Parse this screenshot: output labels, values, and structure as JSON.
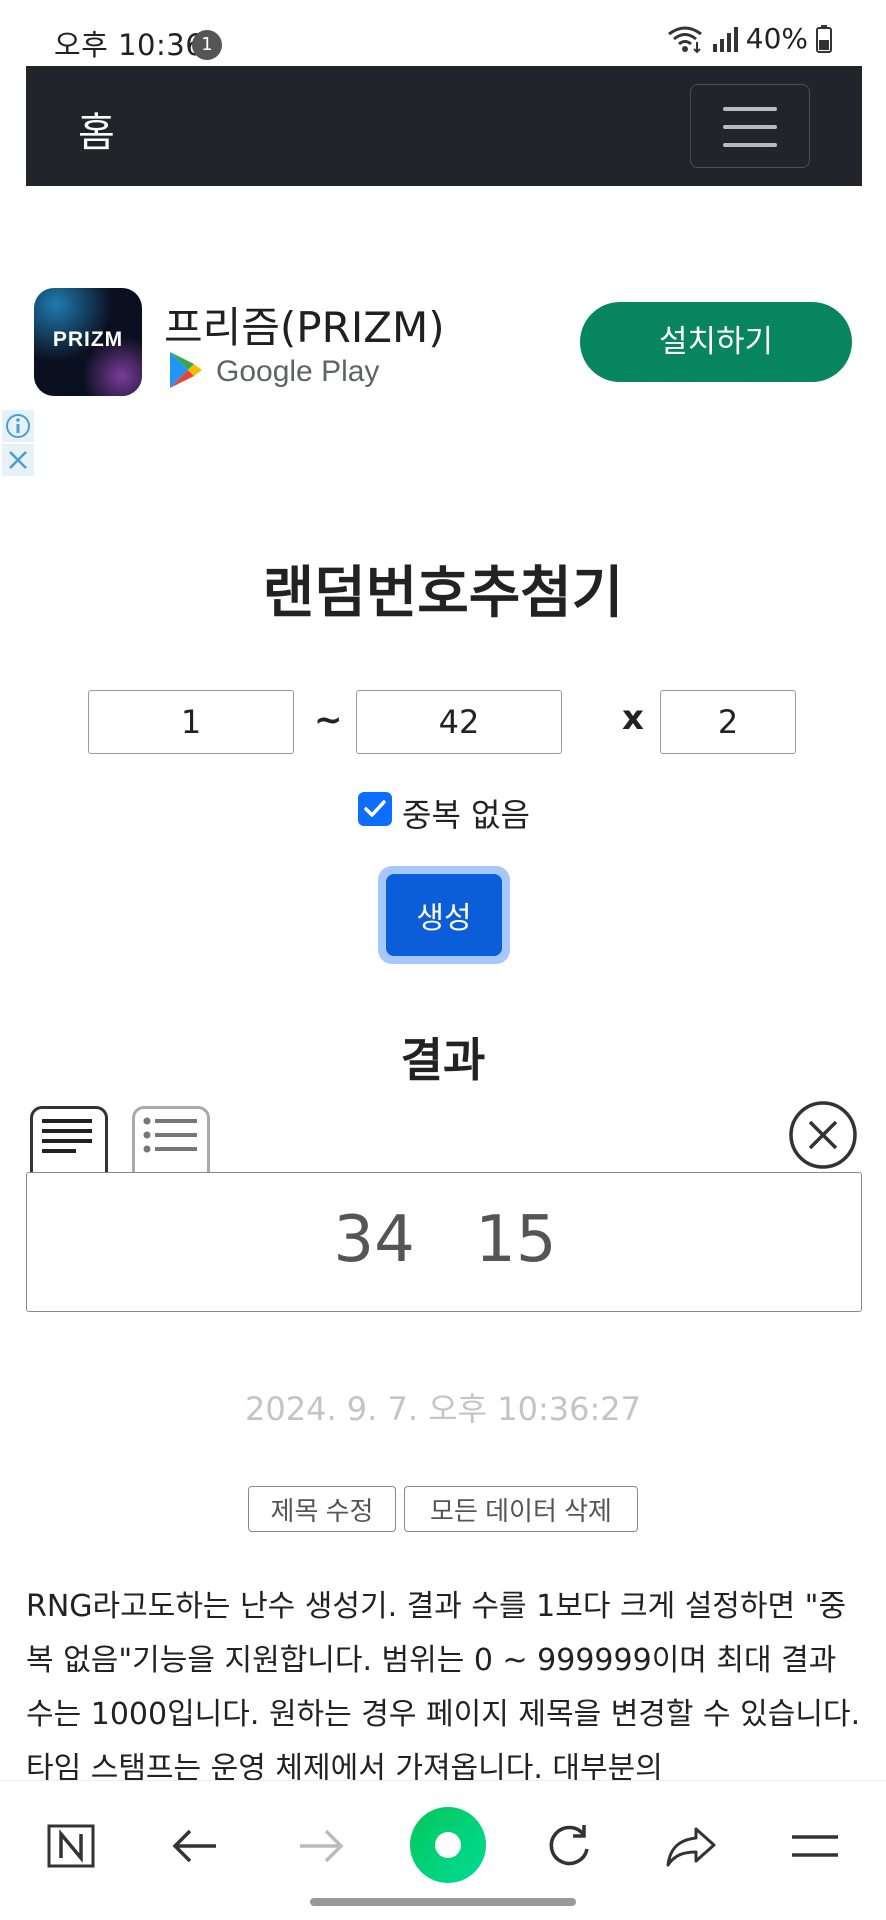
{
  "status_bar": {
    "time": "오후 10:36",
    "notification_count": "1",
    "battery": "40%"
  },
  "navbar": {
    "brand": "홈"
  },
  "ad": {
    "title": "프리즘(PRIZM)",
    "logo_text": "PRIZM",
    "store": "Google Play",
    "install_label": "설치하기"
  },
  "main": {
    "title": "랜덤번호추첨기",
    "min": "1",
    "max": "42",
    "count": "2",
    "range_sep": "~",
    "count_sep": "x",
    "no_duplicate_label": "중복 없음",
    "no_duplicate_checked": true,
    "generate_label": "생성",
    "result_title": "결과",
    "results": "34  15",
    "timestamp": "2024. 9. 7. 오후 10:36:27",
    "edit_title_label": "제목 수정",
    "delete_all_label": "모든 데이터 삭제",
    "description": "RNG라고도하는 난수 생성기. 결과 수를 1보다 크게 설정하면 \"중복 없음\"기능을 지원합니다. 범위는 0 ~ 999999이며 최대 결과 수는 1000입니다. 원하는 경우 페이지 제목을 변경할 수 있습니다. 타임 스탬프는 운영 체제에서 가져옵니다. 대부분의"
  },
  "colors": {
    "navbar": "#212529",
    "primary": "#0b5ed7",
    "install": "#07855d",
    "browser_accent": "#03c75a"
  },
  "bottom_bar": {
    "icons": [
      "naver-n-icon",
      "back-arrow-icon",
      "forward-arrow-icon",
      "naver-home-icon",
      "refresh-icon",
      "share-icon",
      "menu-icon"
    ]
  }
}
